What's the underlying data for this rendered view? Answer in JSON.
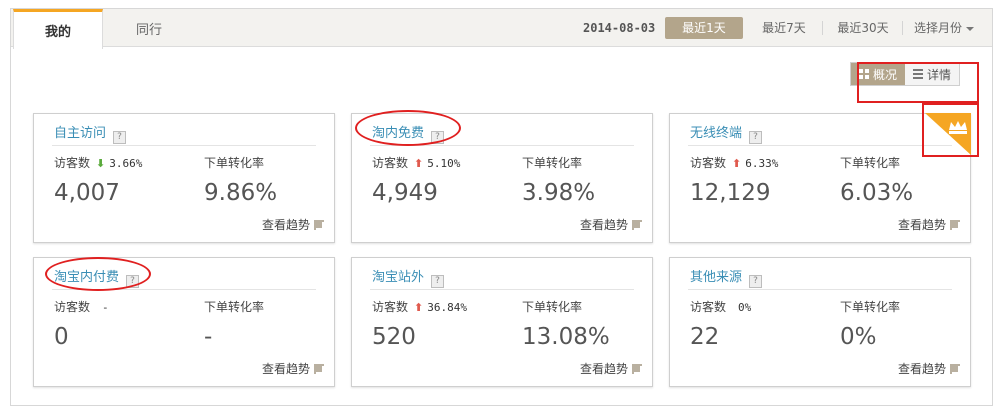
{
  "header": {
    "tabs": [
      {
        "label": "我的",
        "active": true
      },
      {
        "label": "同行",
        "active": false
      }
    ],
    "date": "2014-08-03",
    "ranges": [
      {
        "label": "最近1天",
        "selected": true
      },
      {
        "label": "最近7天",
        "selected": false
      },
      {
        "label": "最近30天",
        "selected": false
      }
    ],
    "month_select": "选择月份"
  },
  "view_toggle": {
    "overview": "概况",
    "detail": "详情",
    "active": "overview"
  },
  "labels": {
    "visitors": "访客数",
    "conversion": "下单转化率",
    "trend": "查看趋势",
    "help": "?"
  },
  "cards": [
    {
      "title": "自主访问",
      "direction": "down",
      "arrow": "⬇",
      "change": "3.66%",
      "visitors": "4,007",
      "conversion": "9.86%"
    },
    {
      "title": "淘内免费",
      "direction": "up",
      "arrow": "⬆",
      "change": "5.10%",
      "visitors": "4,949",
      "conversion": "3.98%"
    },
    {
      "title": "无线终端",
      "direction": "up",
      "arrow": "⬆",
      "change": "6.33%",
      "visitors": "12,129",
      "conversion": "6.03%"
    },
    {
      "title": "淘宝内付费",
      "direction": "none",
      "arrow": "",
      "change": "-",
      "visitors": "0",
      "conversion": "-"
    },
    {
      "title": "淘宝站外",
      "direction": "up",
      "arrow": "⬆",
      "change": "36.84%",
      "visitors": "520",
      "conversion": "13.08%"
    },
    {
      "title": "其他来源",
      "direction": "none",
      "arrow": "",
      "change": "0%",
      "visitors": "22",
      "conversion": "0%"
    }
  ],
  "colors": {
    "accent": "#f5a623",
    "selected_bg": "#b3a58b",
    "title_link": "#3a8eb5",
    "up": "#e05a4e",
    "down": "#5aaa3c",
    "highlight": "#e02020"
  },
  "icons": [
    "grid-icon",
    "list-icon",
    "crown-icon",
    "help-icon",
    "trend-arrow-icon",
    "caret-down-icon"
  ]
}
